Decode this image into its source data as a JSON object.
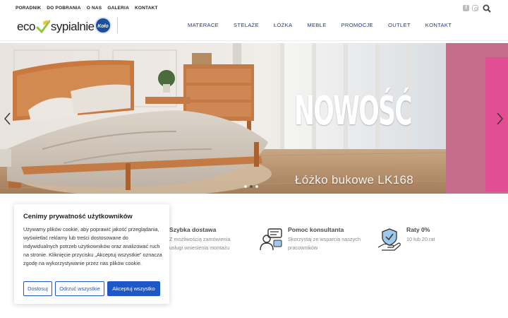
{
  "top_links": [
    "PORADNIK",
    "DO POBRANIA",
    "O NAS",
    "GALERIA",
    "KONTAKT"
  ],
  "logo": {
    "part1": "eco",
    "part2": "sypialnie",
    "badge": "Koło"
  },
  "nav": [
    "MATERACE",
    "STELAŻE",
    "ŁÓŻKA",
    "MEBLE",
    "PROMOCJE",
    "OUTLET",
    "KONTAKT"
  ],
  "hero": {
    "title": "NOWOŚĆ",
    "subtitle": "Łóżko bukowe LK168"
  },
  "features": [
    {
      "title": "Szybka dostawa",
      "desc1": "Z możliwością zamówienia",
      "desc2": "usługi wniesienia montażu"
    },
    {
      "title": "Pomoc konsultanta",
      "desc1": "Skorzystaj ze wsparcia naszych",
      "desc2": "pracowników"
    },
    {
      "title": "Raty 0%",
      "desc1": "10 lub 20 rat",
      "desc2": ""
    }
  ],
  "cookie": {
    "title": "Cenimy prywatność użytkowników",
    "text": "Używamy plików cookie, aby poprawić jakość przeglądania, wyświetlać reklamy lub treści dostosowane do indywidualnych potrzeb użytkowników oraz analizować ruch na stronie. Kliknięcie przycisku „Akceptuj wszystkie” oznacza zgodę na wykorzystywanie przez nas plików cookie.",
    "btn_customize": "Dostosuj",
    "btn_reject": "Odrzuć wszystkie",
    "btn_accept": "Akceptuj wszystko"
  },
  "colors": {
    "nav": "#1d3b8a",
    "accent": "#1d57c8",
    "logo_green": "#8dc63f",
    "hero_pink": "#e24e91"
  }
}
